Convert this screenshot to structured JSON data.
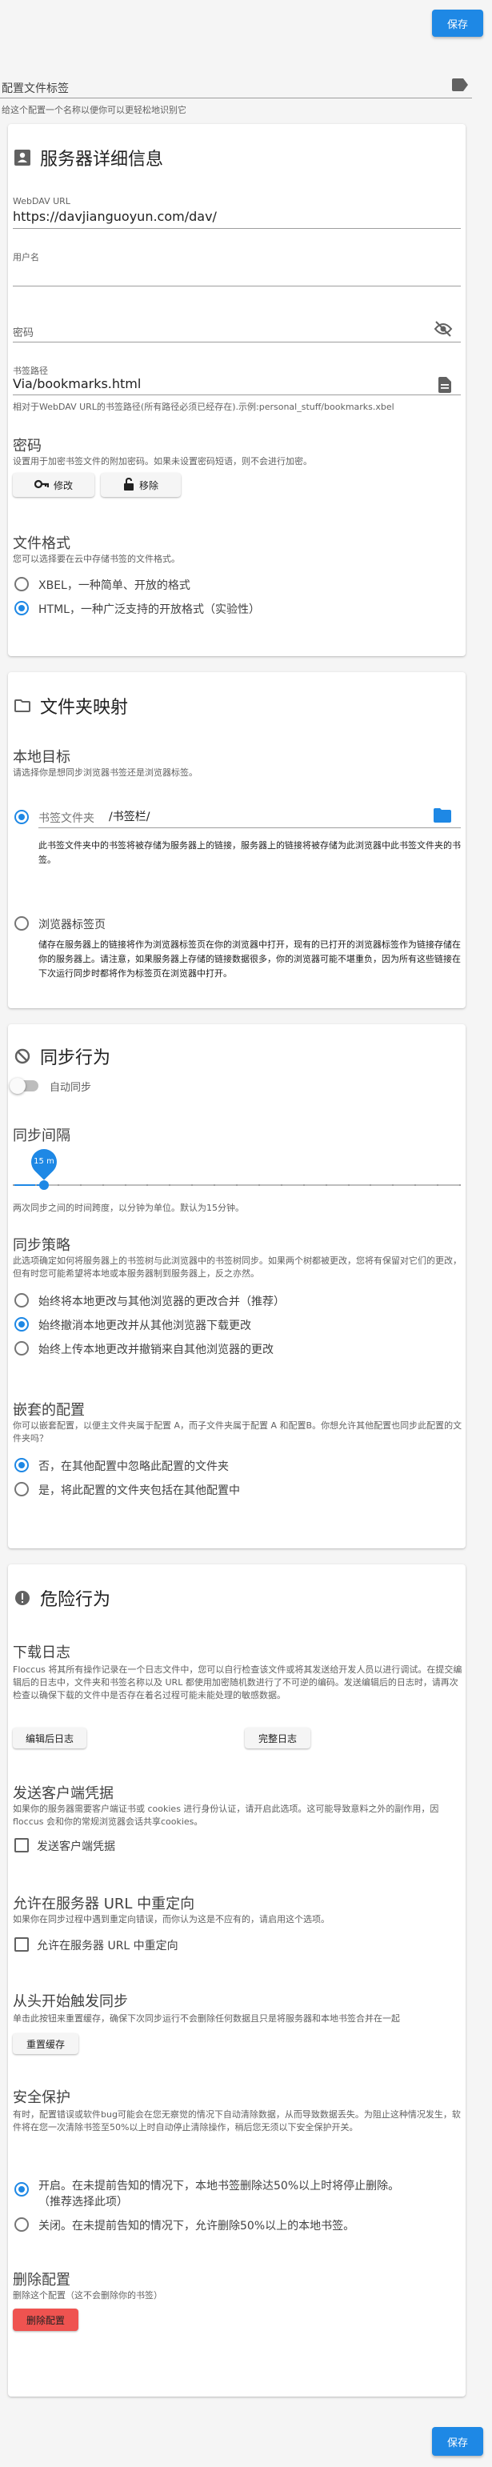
{
  "save_label": "保存",
  "profile": {
    "label": "配置文件标签",
    "hint": "给这个配置一个名称以便你可以更轻松地识别它"
  },
  "server": {
    "title": "服务器详细信息",
    "url_label": "WebDAV URL",
    "url_value": "https://davjianguoyun.com/dav/",
    "user_label": "用户名",
    "user_value": "",
    "pass_label": "密码",
    "bookmark_label": "书签路径",
    "bookmark_value": "Via/bookmarks.html",
    "bookmark_hint": "相对于WebDAV URL的书签路径(所有路径必须已经存在).示例:personal_stuff/bookmarks.xbel",
    "password_heading": "密码",
    "password_desc": "设置用于加密书签文件的附加密码。如果未设置密码短语，则不会进行加密。",
    "modify_label": "修改",
    "remove_label": "移除",
    "format_heading": "文件格式",
    "format_desc": "您可以选择要在云中存储书签的文件格式。",
    "format_xbel": "XBEL，一种简单、开放的格式",
    "format_html": "HTML，一种广泛支持的开放格式（实验性）"
  },
  "folder": {
    "title": "文件夹映射",
    "target_heading": "本地目标",
    "target_desc": "请选择你是想同步浏览器书签还是浏览器标签。",
    "bookmark_folder_label": "书签文件夹",
    "bookmark_folder_value": "/书签栏/",
    "bookmark_folder_desc": "此书签文件夹中的书签将被存储为服务器上的链接，服务器上的链接将被存储为此浏览器中此书签文件夹的书签。",
    "tabs_label": "浏览器标签页",
    "tabs_desc": "储存在服务器上的链接将作为浏览器标签页在你的浏览器中打开，现有的已打开的浏览器标签作为链接存储在你的服务器上。请注意，如果服务器上存储的链接数据很多，你的浏览器可能不堪重负，因为所有这些链接在下次运行同步时都将作为标签页在浏览器中打开。"
  },
  "sync": {
    "title": "同步行为",
    "auto_sync_label": "自动同步",
    "interval_heading": "同步间隔",
    "interval_value": "15 m",
    "interval_fraction": 0.07,
    "interval_desc": "两次同步之间的时间跨度，以分钟为单位。默认为15分钟。",
    "strategy_heading": "同步策略",
    "strategy_desc": "此选项确定如何将服务器上的书签树与此浏览器中的书签树同步。如果两个树都被更改，您将有保留对它们的更改，但有时您可能希望将本地或本服务器制到服务器上，反之亦然。",
    "strategy_opt1": "始终将本地更改与其他浏览器的更改合并（推荐）",
    "strategy_opt2": "始终撤消本地更改并从其他浏览器下载更改",
    "strategy_opt3": "始终上传本地更改并撤销来自其他浏览器的更改",
    "nested_heading": "嵌套的配置",
    "nested_desc": "你可以嵌套配置，以便主文件夹属于配置 A，而子文件夹属于配置 A 和配置B。你想允许其他配置也同步此配置的文件夹吗？",
    "nested_opt1": "否，在其他配置中忽略此配置的文件夹",
    "nested_opt2": "是，将此配置的文件夹包括在其他配置中"
  },
  "danger": {
    "title": "危险行为",
    "logs_heading": "下载日志",
    "logs_desc": "Floccus 将其所有操作记录在一个日志文件中，您可以自行检查该文件或将其发送给开发人员以进行调试。在提交编辑后的日志中，文件夹和书签名称以及 URL 都使用加密随机数进行了不可逆的编码。发送编辑后的日志时，请再次检查以确保下载的文件中是否存在着名过程可能未能处理的敏感数据。",
    "logs_btn_redacted": "编辑后日志",
    "logs_btn_full": "完整日志",
    "cookies_heading": "发送客户端凭据",
    "cookies_desc": "如果你的服务器需要客户端证书或 cookies 进行身份认证，请开启此选项。这可能导致意料之外的副作用，因 floccus 会和你的常规浏览器会话共享cookies。",
    "cookies_check": "发送客户端凭据",
    "redirect_heading": "允许在服务器 URL 中重定向",
    "redirect_desc": "如果你在同步过程中遇到重定向错误，而你认为这是不应有的，请启用这个选项。",
    "redirect_check": "允许在服务器 URL 中重定向",
    "reset_heading": "从头开始触发同步",
    "reset_desc": "单击此按钮来重置缓存，确保下次同步运行不会删除任何数据且只是将服务器和本地书签合并在一起",
    "reset_btn": "重置缓存",
    "safety_heading": "安全保护",
    "safety_desc": "有时，配置错误或软件bug可能会在您无察觉的情况下自动清除数据，从而导致数据丢失。为阻止这种情况发生，软件将在您一次清除书签至50%以上时自动停止清除操作，稍后您无须以下安全保护开关。",
    "safety_on_line1": "开启。在未提前告知的情况下，本地书签删除达50%以上时将停止删除。",
    "safety_on_line2": "（推荐选择此项）",
    "safety_off": "关闭。在未提前告知的情况下，允许删除50%以上的本地书签。",
    "delete_heading": "删除配置",
    "delete_desc": "删除这个配置（这不会删除你的书签）",
    "delete_btn": "删除配置"
  },
  "colors": {
    "accent": "#1e88e5",
    "danger": "#ef5350"
  }
}
